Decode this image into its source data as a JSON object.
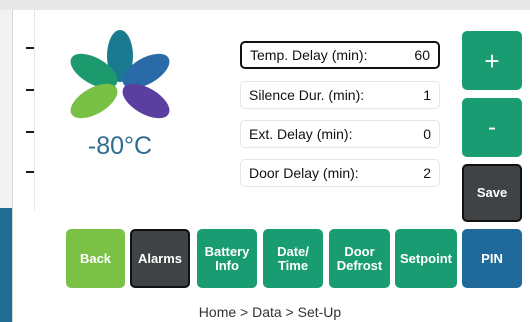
{
  "display": {
    "temperature": "-80°C"
  },
  "fields": [
    {
      "label": "Temp. Delay (min):",
      "value": "60"
    },
    {
      "label": "Silence Dur. (min):",
      "value": "1"
    },
    {
      "label": "Ext. Delay (min):",
      "value": "0"
    },
    {
      "label": "Door Delay (min):",
      "value": "2"
    }
  ],
  "side_buttons": {
    "plus": "+",
    "minus": "-",
    "save": "Save"
  },
  "nav": {
    "back": "Back",
    "alarms": "Alarms",
    "battery_line1": "Battery",
    "battery_line2": "Info",
    "datetime_line1": "Date/",
    "datetime_line2": "Time",
    "defrost_line1": "Door",
    "defrost_line2": "Defrost",
    "setpoint": "Setpoint",
    "pin": "PIN"
  },
  "breadcrumb": "Home > Data > Set-Up",
  "colors": {
    "green": "#1a9c73",
    "lime": "#7bc146",
    "dark": "#404345",
    "blue": "#1f6a9a",
    "petal_teal": "#1a7a8f",
    "petal_green": "#1c9a6e",
    "petal_blue": "#2a6aa8",
    "petal_lime": "#78c046",
    "petal_purple": "#5b3fa0",
    "temp_text": "#2e6c8f"
  }
}
